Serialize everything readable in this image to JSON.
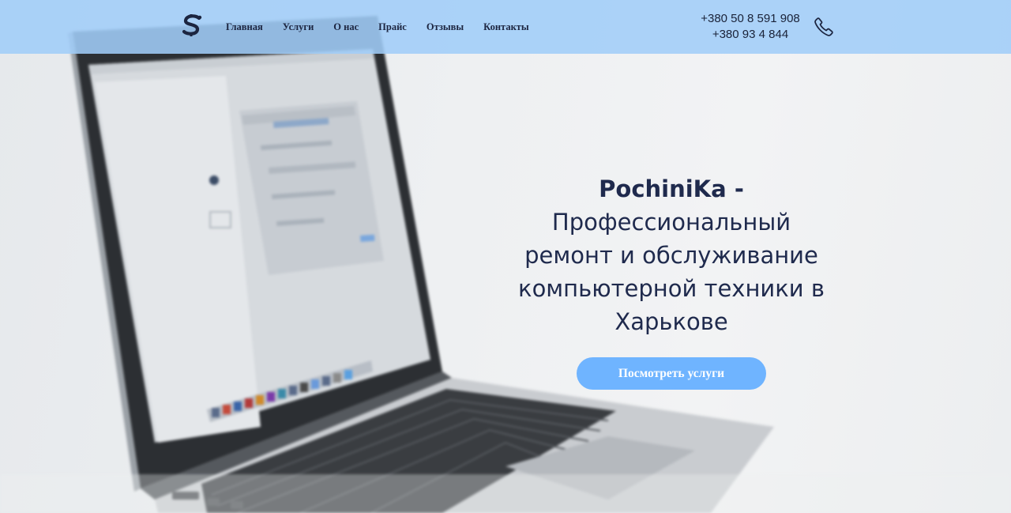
{
  "header": {
    "logo_text": "S",
    "nav": [
      {
        "label": "Главная"
      },
      {
        "label": "Услуги"
      },
      {
        "label": "О нас"
      },
      {
        "label": "Прайс"
      },
      {
        "label": "Отзывы"
      },
      {
        "label": "Контакты"
      }
    ],
    "phones": [
      "+380 50 8 591 908",
      "+380 93 4 844"
    ],
    "phone_icon": "phone-icon"
  },
  "hero": {
    "brand": "PochiniKa -",
    "line1": "Профессиональный",
    "line2": "ремонт и обслуживание",
    "line3": "компьютерной техники в",
    "line4": "Харькове",
    "cta_label": "Посмотреть услуги",
    "background_image": "laptop-photo"
  },
  "colors": {
    "header_bg": "#a0cdf8",
    "text_dark": "#1f2a4d",
    "cta_bg": "#6fb4ff",
    "cta_text": "#ffffff"
  }
}
